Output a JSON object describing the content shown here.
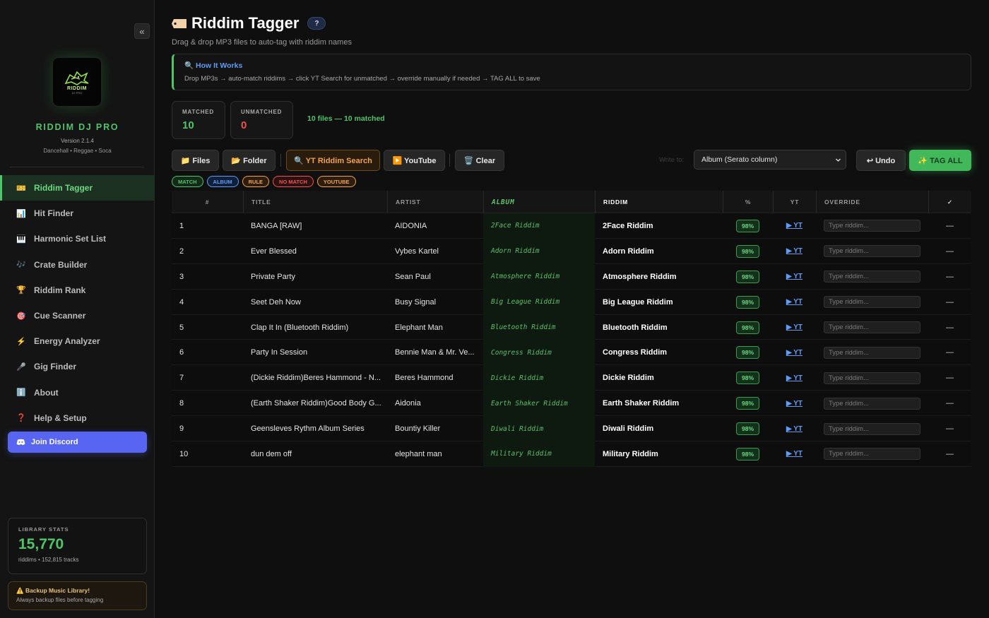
{
  "sidebar": {
    "collapse_label": "«",
    "logo_text": "RIDDIM",
    "logo_sub": "DJ PRO",
    "brand": "RIDDIM DJ PRO",
    "version": "Version 2.1.4",
    "genres": "Dancehall • Reggae • Soca",
    "items": [
      {
        "icon": "🎫",
        "icon_name": "ticket-icon",
        "label": "Riddim Tagger",
        "active": true
      },
      {
        "icon": "📊",
        "icon_name": "bar-chart-icon",
        "label": "Hit Finder"
      },
      {
        "icon": "🎹",
        "icon_name": "piano-icon",
        "label": "Harmonic Set List"
      },
      {
        "icon": "🎶",
        "icon_name": "music-notes-icon",
        "label": "Crate Builder"
      },
      {
        "icon": "🏆",
        "icon_name": "trophy-icon",
        "label": "Riddim Rank"
      },
      {
        "icon": "🎯",
        "icon_name": "target-icon",
        "label": "Cue Scanner"
      },
      {
        "icon": "⚡",
        "icon_name": "lightning-icon",
        "label": "Energy Analyzer"
      },
      {
        "icon": "🎤",
        "icon_name": "microphone-icon",
        "label": "Gig Finder"
      },
      {
        "icon": "ℹ️",
        "icon_name": "info-icon",
        "label": "About"
      },
      {
        "icon": "❓",
        "icon_name": "question-icon",
        "label": "Help & Setup"
      }
    ],
    "discord_label": "Join Discord",
    "stats": {
      "label": "LIBRARY STATS",
      "value": "15,770",
      "sub": "riddims • 152,815 tracks"
    },
    "backup": {
      "title": "⚠️ Backup Music Library!",
      "sub": "Always backup files before tagging"
    }
  },
  "header": {
    "title": "Riddim Tagger",
    "help": "?",
    "subtitle": "Drag & drop MP3 files to auto-tag with riddim names"
  },
  "how": {
    "title": "🔍 How It Works",
    "text": "Drop MP3s → auto-match riddims → click YT Search for unmatched → override manually if needed → TAG ALL to save"
  },
  "stats": {
    "matched_label": "MATCHED",
    "matched": "10",
    "unmatched_label": "UNMATCHED",
    "unmatched": "0",
    "summary": "10 files — 10 matched"
  },
  "toolbar": {
    "files": "📁 Files",
    "folder": "📂 Folder",
    "yt_search": "🔍 YT Riddim Search",
    "youtube": "▶️ YouTube",
    "clear": "🗑️ Clear",
    "write_label": "Write to:",
    "write_value": "Album (Serato column)",
    "undo": "↩ Undo",
    "tag_all": "✨ TAG ALL"
  },
  "legend": [
    {
      "label": "MATCH",
      "color": "#4fc46a",
      "bg": "#122a17"
    },
    {
      "label": "ALBUM",
      "color": "#5e9cf5",
      "bg": "#11203a"
    },
    {
      "label": "RULE",
      "color": "#f1a24a",
      "bg": "#2d1d0c"
    },
    {
      "label": "NO MATCH",
      "color": "#ef5350",
      "bg": "#2d1111"
    },
    {
      "label": "YOUTUBE",
      "color": "#f1a24a",
      "bg": "#2d1d0c"
    }
  ],
  "columns": [
    "#",
    "TITLE",
    "ARTIST",
    "ALBUM",
    "RIDDIM",
    "%",
    "YT",
    "OVERRIDE",
    "✓"
  ],
  "rows": [
    {
      "num": "1",
      "title": "BANGA [RAW]",
      "artist": "AIDONIA",
      "album": "2Face Riddim",
      "riddim": "2Face Riddim",
      "pct": "98%",
      "yt": "▶ YT",
      "override": "Type riddim...",
      "check": "—"
    },
    {
      "num": "2",
      "title": "Ever Blessed",
      "artist": "Vybes Kartel",
      "album": "Adorn Riddim",
      "riddim": "Adorn Riddim",
      "pct": "98%",
      "yt": "▶ YT",
      "override": "Type riddim...",
      "check": "—"
    },
    {
      "num": "3",
      "title": "Private Party",
      "artist": "Sean Paul",
      "album": "Atmosphere Riddim",
      "riddim": "Atmosphere Riddim",
      "pct": "98%",
      "yt": "▶ YT",
      "override": "Type riddim...",
      "check": "—"
    },
    {
      "num": "4",
      "title": "Seet Deh Now",
      "artist": "Busy Signal",
      "album": "Big League Riddim",
      "riddim": "Big League Riddim",
      "pct": "98%",
      "yt": "▶ YT",
      "override": "Type riddim...",
      "check": "—"
    },
    {
      "num": "5",
      "title": "Clap It In (Bluetooth Riddim)",
      "artist": "Elephant Man",
      "album": "Bluetooth Riddim",
      "riddim": "Bluetooth Riddim",
      "pct": "98%",
      "yt": "▶ YT",
      "override": "Type riddim...",
      "check": "—"
    },
    {
      "num": "6",
      "title": "Party In Session",
      "artist": "Bennie Man & Mr. Ve...",
      "album": "Congress Riddim",
      "riddim": "Congress Riddim",
      "pct": "98%",
      "yt": "▶ YT",
      "override": "Type riddim...",
      "check": "—"
    },
    {
      "num": "7",
      "title": "(Dickie Riddim)Beres Hammond - N...",
      "artist": "Beres Hammond",
      "album": "Dickie Riddim",
      "riddim": "Dickie Riddim",
      "pct": "98%",
      "yt": "▶ YT",
      "override": "Type riddim...",
      "check": "—"
    },
    {
      "num": "8",
      "title": "(Earth Shaker Riddim)Good Body G...",
      "artist": "Aidonia",
      "album": "Earth Shaker Riddim",
      "riddim": "Earth Shaker Riddim",
      "pct": "98%",
      "yt": "▶ YT",
      "override": "Type riddim...",
      "check": "—"
    },
    {
      "num": "9",
      "title": "Geensleves Rythm Album Series",
      "artist": "Bountiy Killer",
      "album": "Diwali Riddim",
      "riddim": "Diwali Riddim",
      "pct": "98%",
      "yt": "▶ YT",
      "override": "Type riddim...",
      "check": "—"
    },
    {
      "num": "10",
      "title": "dun dem off",
      "artist": "elephant man",
      "album": "Military Riddim",
      "riddim": "Military Riddim",
      "pct": "98%",
      "yt": "▶ YT",
      "override": "Type riddim...",
      "check": "—"
    }
  ]
}
